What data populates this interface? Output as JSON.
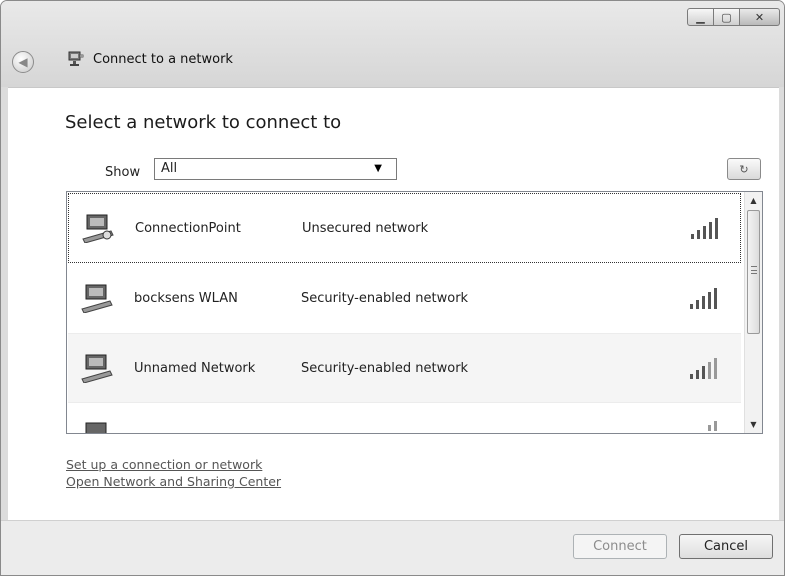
{
  "window": {
    "title": "Connect to a network",
    "controls": {
      "minimize_icon": "minimize-icon",
      "maximize_icon": "maximize-icon",
      "close_icon": "close-icon"
    }
  },
  "main": {
    "heading": "Select a network to connect to",
    "show_label": "Show",
    "show_value": "All"
  },
  "networks": [
    {
      "name": "ConnectionPoint",
      "security": "Unsecured network",
      "focused": true
    },
    {
      "name": "bocksens WLAN",
      "security": "Security-enabled network"
    },
    {
      "name": "Unnamed Network",
      "security": "Security-enabled network"
    }
  ],
  "links": {
    "setup": "Set up a connection or network",
    "sharing_center": "Open Network and Sharing Center"
  },
  "buttons": {
    "connect": "Connect",
    "cancel": "Cancel"
  }
}
